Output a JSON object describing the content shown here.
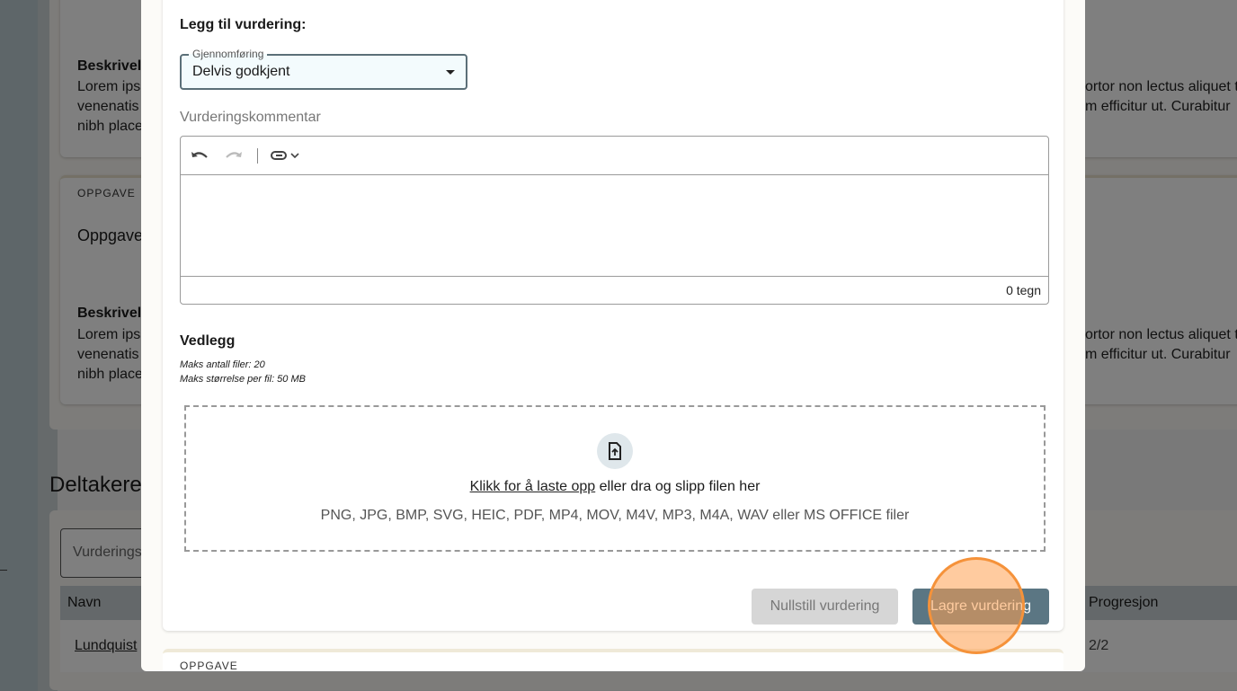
{
  "background": {
    "card1": {
      "desc_title": "Beskrivelse",
      "lines": [
        "Lorem ipsum",
        "venenatis",
        "nibh placerat"
      ],
      "right_lines": [
        "ortor non lectus aliquet t",
        "m efficitur ut. Curabitur"
      ]
    },
    "card2": {
      "label": "OPPGAVE",
      "title": "Oppgave",
      "desc_title": "Beskrivelse",
      "lines": [
        "Lorem ipsum",
        "venenatis",
        "nibh placerat"
      ],
      "right_lines": [
        "ortor non lectus aliquet t",
        "m efficitur ut. Curabitur"
      ]
    },
    "participants_heading": "Deltakere",
    "filter_placeholder": "Vurderingsstatus",
    "table": {
      "columns": [
        "Navn",
        "Progresjon"
      ],
      "rows": [
        {
          "name": "Lundquist",
          "progress": "2/2"
        }
      ]
    }
  },
  "modal": {
    "heading": "Legg til vurdering:",
    "select": {
      "label": "Gjennomføring",
      "value": "Delvis godkjent"
    },
    "comment_label": "Vurderingskommentar",
    "char_count": "0 tegn",
    "attachments": {
      "title": "Vedlegg",
      "max_files": "Maks antall filer: 20",
      "max_size": "Maks størrelse per fil: 50 MB",
      "upload_link": "Klikk for å laste opp",
      "upload_rest": " eller dra og slipp filen her",
      "formats": "PNG, JPG, BMP, SVG, HEIC, PDF, MP4, MOV, M4V, MP3, M4A, WAV eller MS OFFICE filer"
    },
    "reset_button": "Nullstill vurdering",
    "save_button": "Lagre vurdering",
    "next_card_label": "OPPGAVE"
  },
  "colors": {
    "primary": "#5b7683",
    "disabled": "#d6d6d6",
    "click_marker": "#f5923a"
  }
}
